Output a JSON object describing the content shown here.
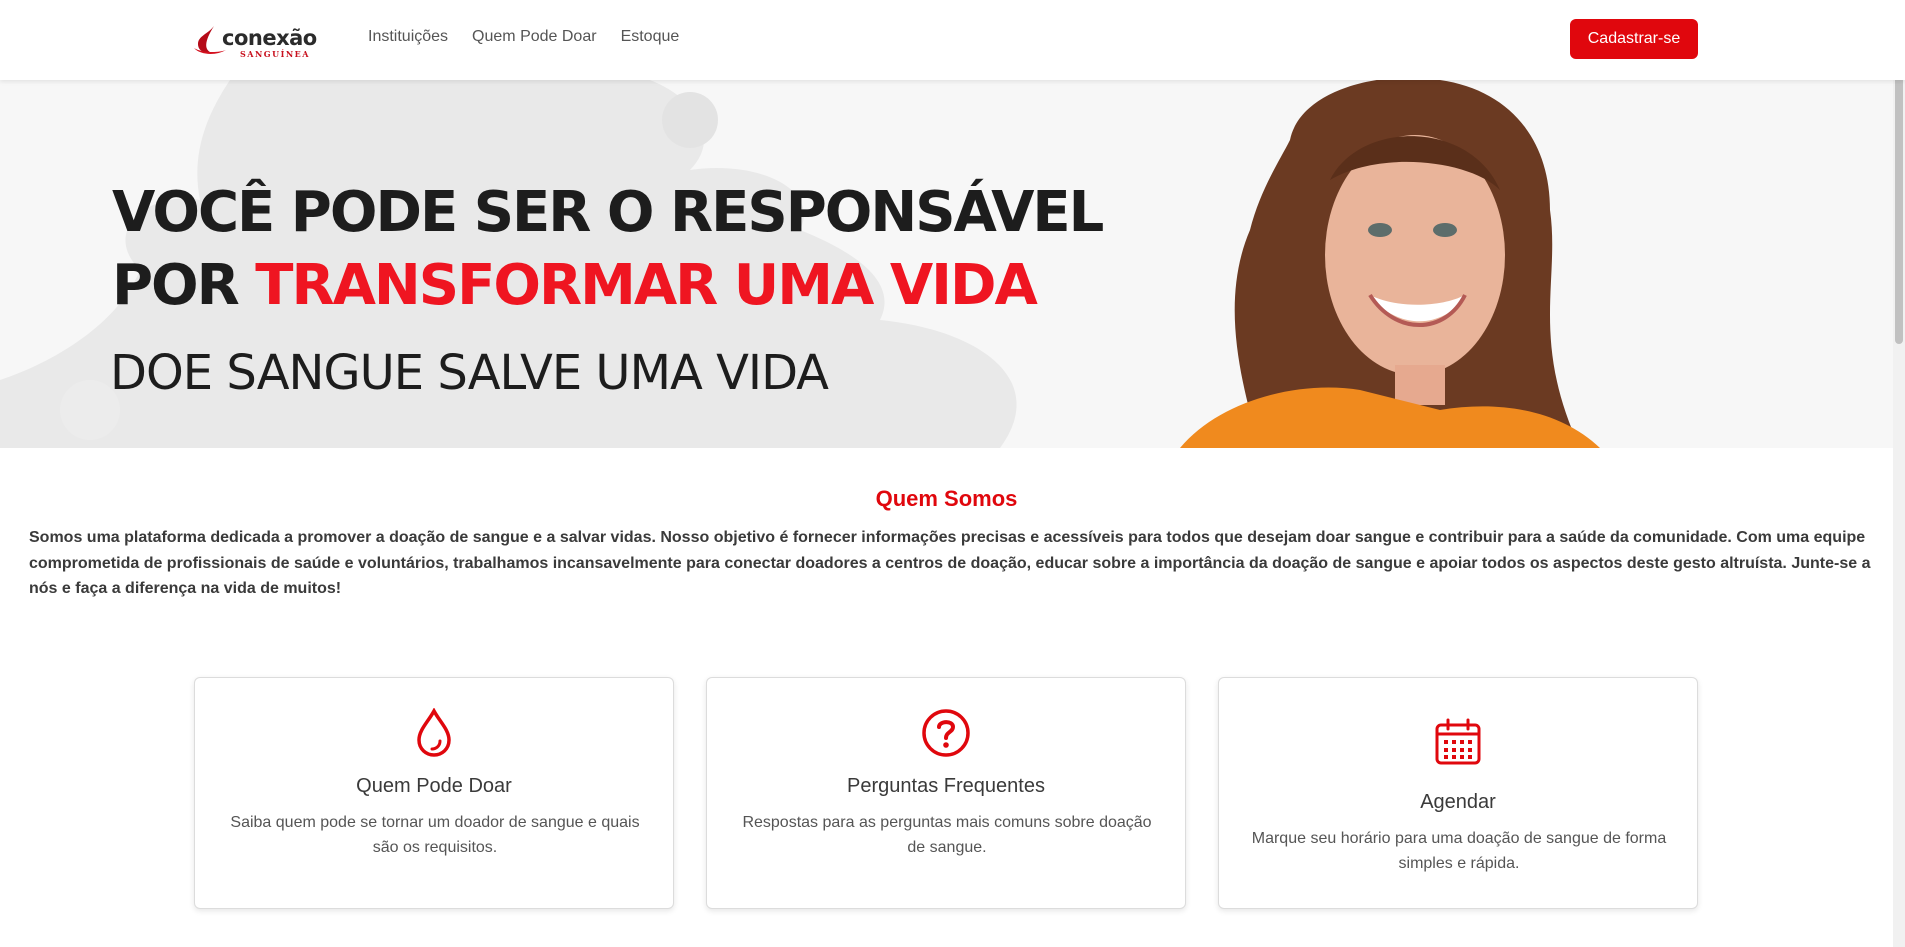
{
  "nav": {
    "brand_name": "conexão",
    "brand_sub": "SANGUÍNEA",
    "links": [
      "Instituições",
      "Quem Pode Doar",
      "Estoque"
    ],
    "signup_label": "Cadastrar-se"
  },
  "hero": {
    "line1": "VOCÊ PODE SER O RESPONSÁVEL",
    "line2_prefix": "POR ",
    "line2_accent": "TRANSFORMAR UMA VIDA",
    "subtitle": "DOE SANGUE SALVE UMA VIDA"
  },
  "about": {
    "title": "Quem Somos",
    "text": "Somos uma plataforma dedicada a promover a doação de sangue e a salvar vidas. Nosso objetivo é fornecer informações precisas e acessíveis para todos que desejam doar sangue e contribuir para a saúde da comunidade. Com uma equipe comprometida de profissionais de saúde e voluntários, trabalhamos incansavelmente para conectar doadores a centros de doação, educar sobre a importância da doação de sangue e apoiar todos os aspectos deste gesto altruísta. Junte-se a nós e faça a diferença na vida de muitos!"
  },
  "cards": [
    {
      "icon": "blood-drop-icon",
      "title": "Quem Pode Doar",
      "desc": "Saiba quem pode se tornar um doador de sangue e quais são os requisitos."
    },
    {
      "icon": "question-circle-icon",
      "title": "Perguntas Frequentes",
      "desc": "Respostas para as perguntas mais comuns sobre doação de sangue."
    },
    {
      "icon": "calendar-icon",
      "title": "Agendar",
      "desc": "Marque seu horário para uma doação de sangue de forma simples e rápida."
    }
  ],
  "colors": {
    "accent": "#e0070d",
    "hero_accent": "#ef1521",
    "text": "#3a3a3a"
  }
}
